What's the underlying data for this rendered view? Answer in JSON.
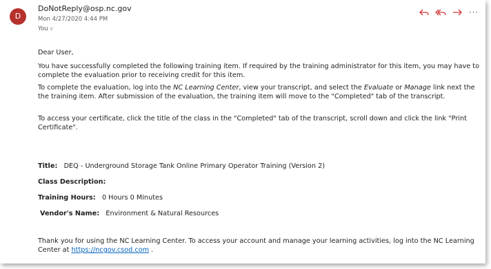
{
  "header": {
    "avatar_letter": "D",
    "sender": "DoNotReply@osp.nc.gov",
    "date": "Mon 4/27/2020 4:44 PM",
    "to": "You",
    "actions": [
      "reply-icon",
      "reply-all-icon",
      "forward-icon",
      "more-icon"
    ],
    "more_label": "···"
  },
  "body": {
    "greeting": "Dear User,",
    "para1": "You have successfully completed the following training item. If required by the training administrator for this item, you may have to complete the evaluation prior to receiving credit for this item.",
    "para2": {
      "t1": "To complete the evaluation, log into the ",
      "em1": "NC Learning Center",
      "t2": ", view your transcript, and select the ",
      "em2": "Evaluate",
      "t3": " or ",
      "em3": "Manage",
      "t4": " link next the the training item. After submission of the evaluation, the training item will move to the \"Completed\" tab of the transcript."
    },
    "para3": "To access your certificate, click the title of the class in the \"Completed\" tab of the transcript, scroll down and click the link \"Print Certificate\".",
    "title_label": "Title:",
    "title_value": "DEQ - Underground Storage Tank Online Primary Operator Training (Version 2)",
    "class_desc_label": "Class Description:",
    "hours_label": "Training Hours:",
    "hours_value": "0 Hours 0 Minutes",
    "vendor_label": "Vendor's Name:",
    "vendor_value": "Environment & Natural Resources",
    "closing_text": "Thank you for using the NC Learning Center. To access your account and manage your learning activities, log into the NC Learning Center at ",
    "closing_link": "https://ncgov.csod.com",
    "closing_end": " ."
  },
  "colors": {
    "avatar": "#b7312c",
    "action_icons": "#d13438",
    "link": "#0563c1"
  }
}
